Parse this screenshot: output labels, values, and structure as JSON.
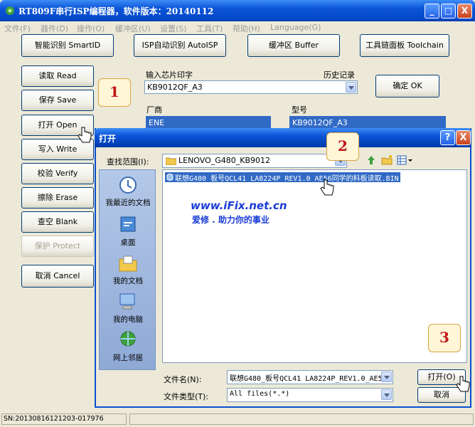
{
  "window": {
    "title": "RT809F串行ISP编程器，软件版本：20140112",
    "minimize": "_",
    "maximize": "□",
    "close": "X"
  },
  "menu": [
    "文件(F)",
    "器件(D)",
    "操作(O)",
    "缓冲区(U)",
    "设置(S)",
    "工具(T)",
    "帮助(H)",
    "Language(G)"
  ],
  "top_buttons": {
    "smart_id": "智能识别 SmartID",
    "isp_auto": "ISP自动识别 AutoISP",
    "buffer": "缓冲区 Buffer",
    "toolchain": "工具链面板 Toolchain"
  },
  "side_buttons": {
    "read": "读取 Read",
    "save": "保存 Save",
    "open": "打开 Open",
    "write": "写入 Write",
    "verify": "校验 Verify",
    "erase": "擦除 Erase",
    "blank": "查空 Blank",
    "protect": "保护 Protect",
    "cancel": "取消 Cancel"
  },
  "chip": {
    "input_label": "输入芯片印字",
    "history_label": "历史记录",
    "input_value": "KB9012QF_A3",
    "confirm": "确定 OK",
    "vendor_label": "厂商",
    "vendor_value": "ENE",
    "model_label": "型号",
    "model_value": "KB9012QF_A3"
  },
  "callouts": [
    "1",
    "2",
    "3"
  ],
  "dialog": {
    "title": "打开",
    "help": "?",
    "close": "X",
    "lookin_label": "查找范围(I):",
    "lookin_value": "LENOVO_G480_KB9012",
    "places": [
      "我最近的文档",
      "桌面",
      "我的文档",
      "我的电脑",
      "网上邻居"
    ],
    "file": "联想G480_板号QCL41 LA8224P_REV1.0_AE56同学的料板读取.BIN",
    "filename_label": "文件名(N):",
    "filename_value": "联想G480_板号QCL41 LA8224P_REV1.0_AE5(",
    "filetype_label": "文件类型(T):",
    "filetype_value": "All files(*.*)",
    "open_button": "打开(O)",
    "cancel_button": "取消"
  },
  "watermark": {
    "url": "www.iFix.net.cn",
    "slogan": "爱修 . 助力你的事业"
  },
  "status": {
    "sn": "SN:20130816121203-017976"
  },
  "colors": {
    "title_blue": "#0a54d8",
    "selection": "#316ac5",
    "callout_number": "#c0181a",
    "watermark": "#1a3cd6"
  }
}
